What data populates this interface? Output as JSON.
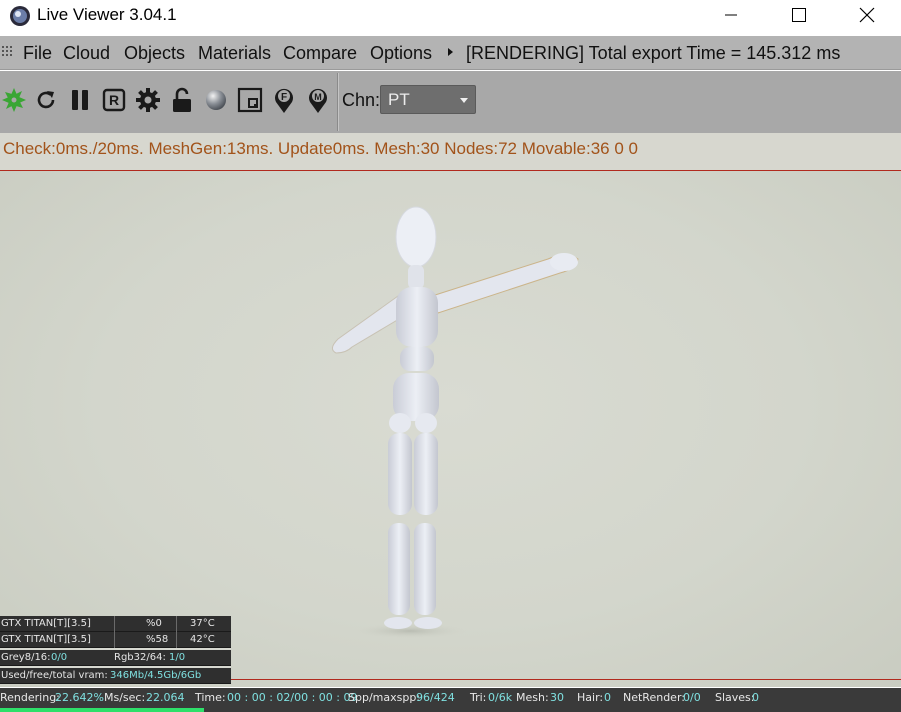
{
  "window": {
    "title": "Live Viewer 3.04.1"
  },
  "menu": {
    "items": [
      "File",
      "Cloud",
      "Objects",
      "Materials",
      "Compare",
      "Options"
    ],
    "status": "[RENDERING] Total export Time = 145.312 ms"
  },
  "toolbar": {
    "icons": [
      "octane-logo-icon",
      "refresh-icon",
      "pause-icon",
      "r-button-icon",
      "settings-gear-icon",
      "lock-icon",
      "sphere-material-icon",
      "region-render-icon",
      "pin-f-icon",
      "pin-m-icon"
    ],
    "channel_label": "Chn:",
    "channel_value": "PT"
  },
  "stats": {
    "text": "Check:0ms./20ms. MeshGen:13ms. Update0ms. Mesh:30 Nodes:72 Movable:36  0 0"
  },
  "gpus": [
    {
      "name": "GTX TITAN[T][3.5]",
      "usage": "%0",
      "temp": "37°C"
    },
    {
      "name": "GTX TITAN[T][3.5]",
      "usage": "%58",
      "temp": "42°C"
    }
  ],
  "memory": {
    "grey_label": "Grey8/16:",
    "grey_value": "0/0",
    "rgb_label": "Rgb32/64:",
    "rgb_value": "1/0",
    "vram_label": "Used/free/total vram:",
    "vram_value": "346Mb/4.5Gb/6Gb"
  },
  "status": {
    "rendering_label": "Rendering:",
    "rendering_value": "22.642%",
    "ms_label": "Ms/sec:",
    "ms_value": "22.064",
    "time_label": "Time:",
    "time_value": "00 : 00 : 02/00 : 00 : 09",
    "spp_label": "Spp/maxspp:",
    "spp_value": "96/424",
    "tri_label": "Tri:",
    "tri_value": "0/6k",
    "mesh_label": "Mesh:",
    "mesh_value": "30",
    "hair_label": "Hair:",
    "hair_value": "0",
    "net_label": "NetRender:",
    "net_value": "0/0",
    "slaves_label": "Slaves:",
    "slaves_value": "0"
  },
  "progress": {
    "fraction": 0.22642
  },
  "colors": {
    "stats_text": "#a2531a",
    "accent_line": "#b12a1e",
    "value_highlight": "#7fe0e0",
    "progress_fill": "#2ee06a"
  }
}
